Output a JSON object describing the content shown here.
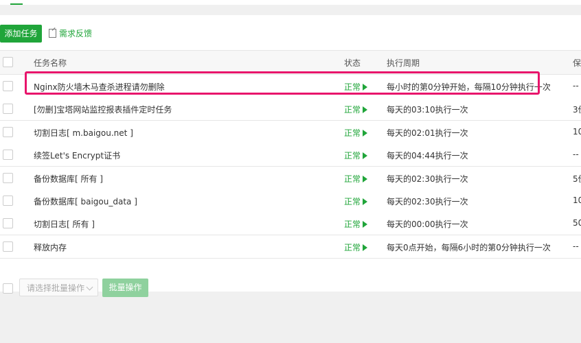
{
  "toolbar": {
    "add_task": "添加任务",
    "feedback": "需求反馈"
  },
  "columns": {
    "name": "任务名称",
    "status": "状态",
    "cycle": "执行周期",
    "backup": "保"
  },
  "rows": [
    {
      "name": "Nginx防火墙木马查杀进程请勿删除",
      "status": "正常",
      "cycle": "每小时的第0分钟开始，每隔10分钟执行一次",
      "backup": "--"
    },
    {
      "name": "[勿删]宝塔网站监控报表插件定时任务",
      "status": "正常",
      "cycle": "每天的03:10执行一次",
      "backup": "3份"
    },
    {
      "name": "切割日志[ m.baigou.net ]",
      "status": "正常",
      "cycle": "每天的02:01执行一次",
      "backup": "10"
    },
    {
      "name": "续签Let's Encrypt证书",
      "status": "正常",
      "cycle": "每天的04:44执行一次",
      "backup": "--"
    },
    {
      "name": "备份数据库[ 所有 ]",
      "status": "正常",
      "cycle": "每天的02:30执行一次",
      "backup": "5份"
    },
    {
      "name": "备份数据库[ baigou_data ]",
      "status": "正常",
      "cycle": "每天的02:30执行一次",
      "backup": "10"
    },
    {
      "name": "切割日志[ 所有 ]",
      "status": "正常",
      "cycle": "每天的00:00执行一次",
      "backup": "50"
    },
    {
      "name": "释放内存",
      "status": "正常",
      "cycle": "每天0点开始，每隔6小时的第0分钟执行一次",
      "backup": "--"
    }
  ],
  "footer": {
    "batch_select_placeholder": "请选择批量操作",
    "batch_button": "批量操作"
  },
  "colors": {
    "accent": "#20a53a",
    "highlight": "#e8146b"
  }
}
